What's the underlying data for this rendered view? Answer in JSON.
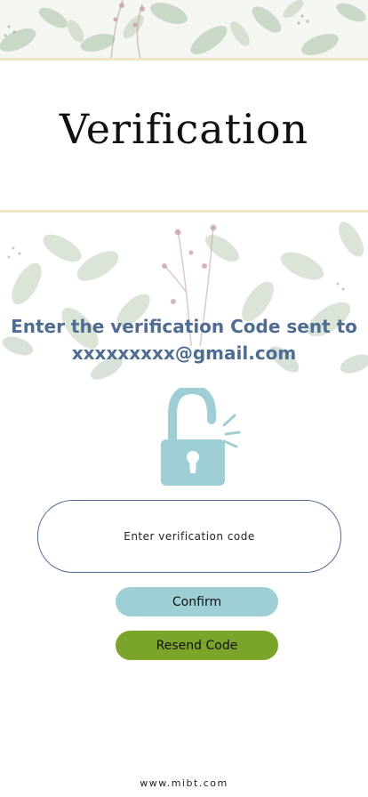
{
  "page": {
    "title": "Verification",
    "instruction_line1": "Enter the verification Code sent to",
    "instruction_line2": "xxxxxxxxx@gmail.com",
    "lock_icon": "unlocked-padlock-icon"
  },
  "form": {
    "code_placeholder": "Enter verification code",
    "code_value": ""
  },
  "buttons": {
    "confirm_label": "Confirm",
    "resend_label": "Resend Code"
  },
  "footer": {
    "url": "www.mibt.com"
  },
  "colors": {
    "heading_blue": "#4f6c91",
    "lock_teal": "#9dcfd5",
    "confirm_bg": "#9dcfd5",
    "resend_bg": "#7ba52a",
    "rule_cream": "#f1e4c6"
  }
}
